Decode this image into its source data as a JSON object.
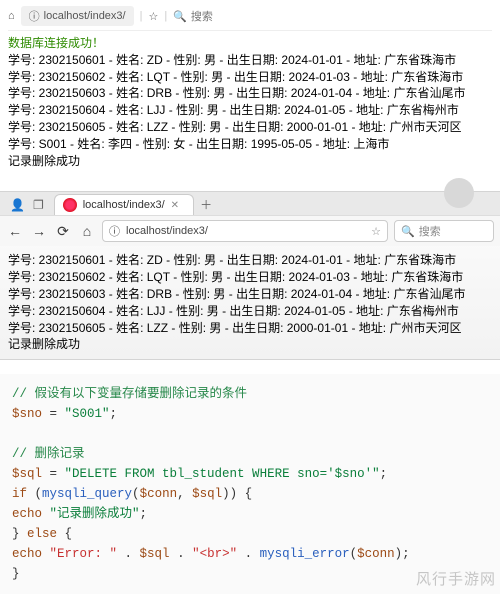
{
  "top_strip": {
    "url": "localhost/index3/",
    "search_placeholder": "搜索"
  },
  "page1": {
    "conn_ok": "数据库连接成功！",
    "rows": [
      "学号: 2302150601 - 姓名: ZD - 性别: 男 - 出生日期: 2024-01-01 - 地址: 广东省珠海市",
      "学号: 2302150602 - 姓名: LQT - 性别: 男 - 出生日期: 2024-01-03 - 地址: 广东省珠海市",
      "学号: 2302150603 - 姓名: DRB - 性别: 男 - 出生日期: 2024-01-04 - 地址: 广东省汕尾市",
      "学号: 2302150604 - 姓名: LJJ - 性别: 男 - 出生日期: 2024-01-05 - 地址: 广东省梅州市",
      "学号: 2302150605 - 姓名: LZZ - 性别: 男 - 出生日期: 2000-01-01 - 地址: 广州市天河区",
      "学号: S001 - 姓名: 李四 - 性别: 女 - 出生日期: 1995-05-05 - 地址: 上海市"
    ],
    "deleted_ok": "记录删除成功"
  },
  "browser": {
    "tab_title": "localhost/index3/",
    "addr": "localhost/index3/",
    "addr_protocol": "ⓘ",
    "search_placeholder": "搜索"
  },
  "page2": {
    "rows": [
      "学号: 2302150601 - 姓名: ZD - 性别: 男 - 出生日期: 2024-01-01 - 地址: 广东省珠海市",
      "学号: 2302150602 - 姓名: LQT - 性别: 男 - 出生日期: 2024-01-03 - 地址: 广东省珠海市",
      "学号: 2302150603 - 姓名: DRB - 性别: 男 - 出生日期: 2024-01-04 - 地址: 广东省汕尾市",
      "学号: 2302150604 - 姓名: LJJ - 性别: 男 - 出生日期: 2024-01-05 - 地址: 广东省梅州市",
      "学号: 2302150605 - 姓名: LZZ - 性别: 男 - 出生日期: 2000-01-01 - 地址: 广州市天河区"
    ],
    "deleted_ok": "记录删除成功"
  },
  "code": {
    "c1": "// 假设有以下变量存储要删除记录的条件",
    "l2a": "$sno",
    "l2b": " = ",
    "l2c": "\"S001\"",
    "l2d": ";",
    "c3": "// 删除记录",
    "l4a": "$sql",
    "l4b": " = ",
    "l4c": "\"DELETE FROM tbl_student WHERE sno='$sno'\"",
    "l4d": ";",
    "l5a": "if",
    "l5b": " (",
    "l5c": "mysqli_query",
    "l5d": "(",
    "l5e": "$conn",
    "l5f": ", ",
    "l5g": "$sql",
    "l5h": ")) {",
    "l6a": "    echo ",
    "l6b": "\"记录删除成功\"",
    "l6c": ";",
    "l7": "} ",
    "l7a": "else",
    "l7b": " {",
    "l8a": "    echo ",
    "l8b": "\"Error: \"",
    "l8c": " . ",
    "l8d": "$sql",
    "l8e": " . ",
    "l8f": "\"<br>\"",
    "l8g": " . ",
    "l8h": "mysqli_error",
    "l8i": "(",
    "l8j": "$conn",
    "l8k": ");",
    "l9": "}"
  },
  "watermark": "风行手游网"
}
